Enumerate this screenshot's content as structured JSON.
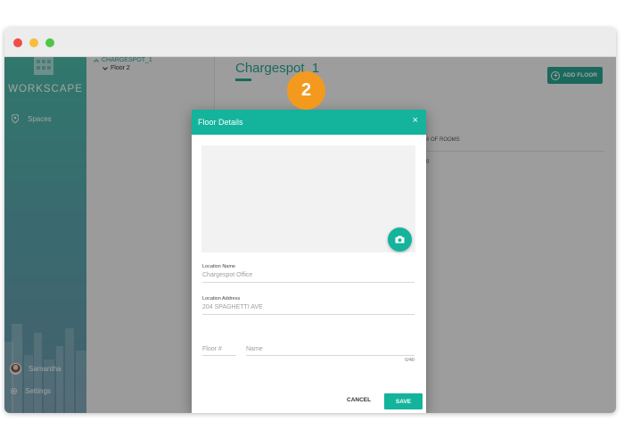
{
  "sidebar": {
    "brand": "WORKSCAPE",
    "nav": {
      "spaces_label": "Spaces"
    },
    "user_name": "Samantha",
    "settings_label": "Settings"
  },
  "tree": {
    "root_label": "CHARGESPOT_1",
    "child_label": "Floor 2"
  },
  "main": {
    "title": "Chargespot_1",
    "add_floor_label": "ADD FLOOR",
    "column_header": "# OF ROOMS",
    "column_value": "0"
  },
  "modal": {
    "title": "Floor Details",
    "close_symbol": "×",
    "location_name_label": "Location Name",
    "location_name_value": "Chargespot Office",
    "location_address_label": "Location Address",
    "location_address_value": "204 SPAGHETTI AVE",
    "floor_number_placeholder": "Floor #",
    "name_placeholder": "Name",
    "name_counter": "0/40",
    "cancel_label": "CANCEL",
    "save_label": "SAVE"
  },
  "step_badge": "2",
  "colors": {
    "accent": "#14b39c",
    "badge": "#f39a1e"
  },
  "icons": [
    "building-logo-icon",
    "location-pin-icon",
    "gear-icon",
    "camera-icon",
    "close-icon",
    "plus-circle-icon",
    "chevron-up-icon",
    "chevron-down-icon"
  ]
}
